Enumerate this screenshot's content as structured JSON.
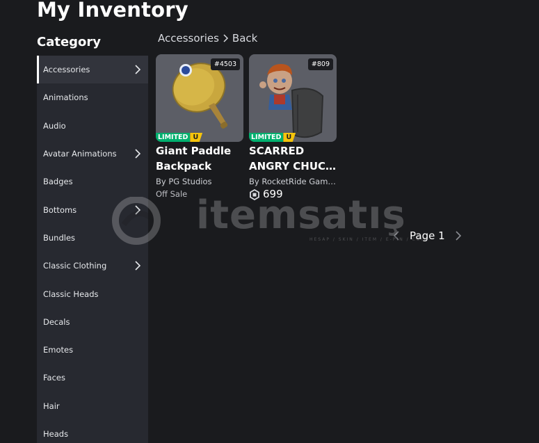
{
  "page": {
    "title": "My Inventory",
    "category_heading": "Category"
  },
  "sidebar": {
    "items": [
      {
        "label": "Accessories",
        "has_chevron": true,
        "active": true
      },
      {
        "label": "Animations",
        "has_chevron": false
      },
      {
        "label": "Audio",
        "has_chevron": false
      },
      {
        "label": "Avatar Animations",
        "has_chevron": true
      },
      {
        "label": "Badges",
        "has_chevron": false
      },
      {
        "label": "Bottoms",
        "has_chevron": true
      },
      {
        "label": "Bundles",
        "has_chevron": false
      },
      {
        "label": "Classic Clothing",
        "has_chevron": true
      },
      {
        "label": "Classic Heads",
        "has_chevron": false
      },
      {
        "label": "Decals",
        "has_chevron": false
      },
      {
        "label": "Emotes",
        "has_chevron": false
      },
      {
        "label": "Faces",
        "has_chevron": false
      },
      {
        "label": "Hair",
        "has_chevron": false
      },
      {
        "label": "Heads",
        "has_chevron": false
      }
    ]
  },
  "breadcrumb": {
    "current": "Accessories",
    "back": "Back"
  },
  "items": [
    {
      "serial": "#4503",
      "limited_label": "LIMITED",
      "unique_label": "U",
      "name_line1": "Giant Paddle",
      "name_line2": "Backpack",
      "by_label": "By",
      "creator": "PG Studios",
      "price": "Off Sale"
    },
    {
      "serial": "#809",
      "limited_label": "LIMITED",
      "unique_label": "U",
      "name_line1": "SCARRED",
      "name_line2": "ANGRY CHUCKY",
      "by_label": "By",
      "creator": "RocketRide Games",
      "price": "699",
      "currency_icon": "robux-icon"
    }
  ],
  "pagination": {
    "label": "Page 1"
  },
  "watermark": {
    "brand": "itemsatış",
    "tagline": "HESAP / SKIN / ITEM / E-PIN / COIN"
  },
  "colors": {
    "background": "#1a1b1e",
    "sidebar": "#272930",
    "limited": "#00b06f",
    "unique": "#f6c40b"
  }
}
